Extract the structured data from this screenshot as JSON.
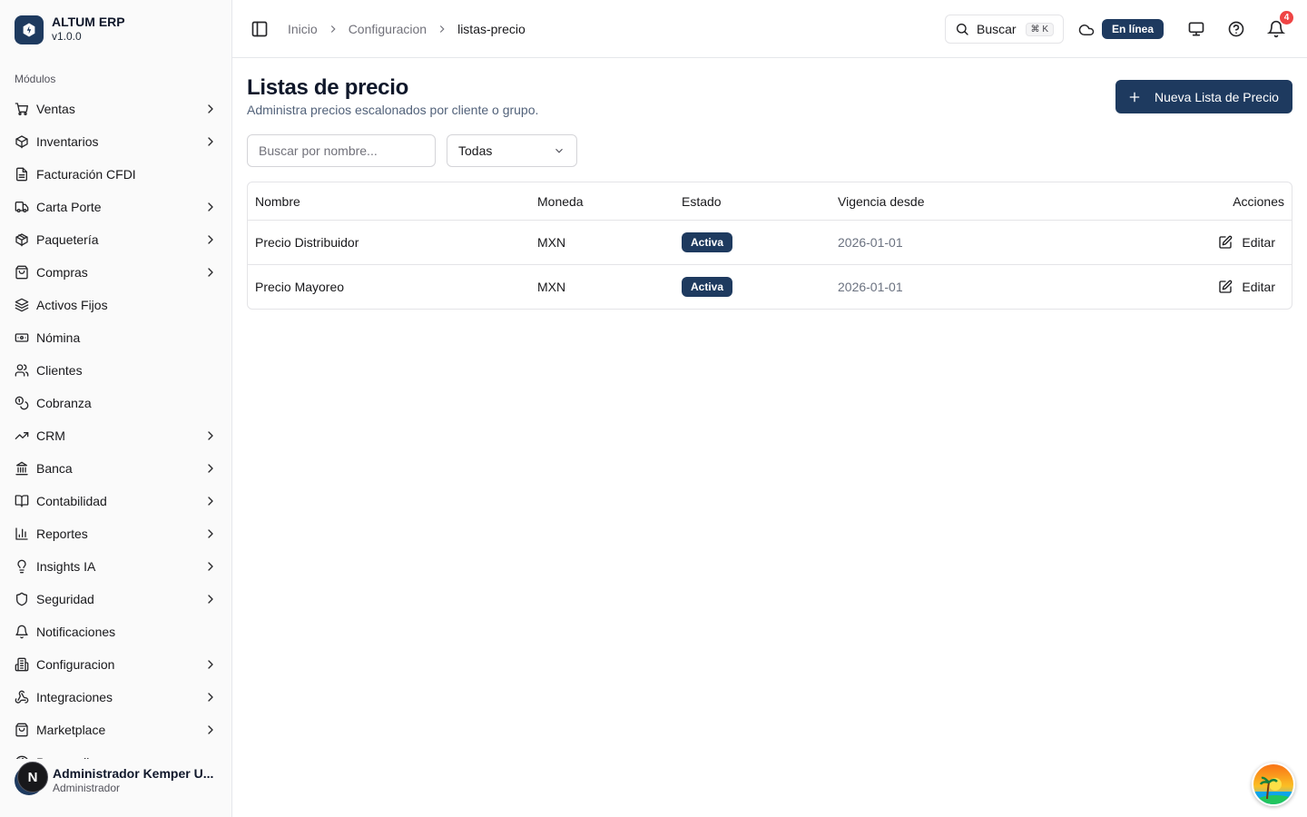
{
  "brand": {
    "name": "ALTUM ERP",
    "version": "v1.0.0"
  },
  "sidebar": {
    "section_title": "Módulos",
    "items": [
      {
        "label": "Ventas",
        "icon": "cart-icon",
        "has_children": true
      },
      {
        "label": "Inventarios",
        "icon": "box-icon",
        "has_children": true
      },
      {
        "label": "Facturación CFDI",
        "icon": "file-icon",
        "has_children": false
      },
      {
        "label": "Carta Porte",
        "icon": "truck-icon",
        "has_children": true
      },
      {
        "label": "Paquetería",
        "icon": "package-icon",
        "has_children": true
      },
      {
        "label": "Compras",
        "icon": "shopping-bag-icon",
        "has_children": true
      },
      {
        "label": "Activos Fijos",
        "icon": "layers-icon",
        "has_children": false
      },
      {
        "label": "Nómina",
        "icon": "banknote-icon",
        "has_children": false
      },
      {
        "label": "Clientes",
        "icon": "users-icon",
        "has_children": false
      },
      {
        "label": "Cobranza",
        "icon": "coins-icon",
        "has_children": false
      },
      {
        "label": "CRM",
        "icon": "trending-up-icon",
        "has_children": true
      },
      {
        "label": "Banca",
        "icon": "bank-icon",
        "has_children": true
      },
      {
        "label": "Contabilidad",
        "icon": "book-icon",
        "has_children": true
      },
      {
        "label": "Reportes",
        "icon": "bar-chart-icon",
        "has_children": true
      },
      {
        "label": "Insights IA",
        "icon": "lightbulb-icon",
        "has_children": true
      },
      {
        "label": "Seguridad",
        "icon": "shield-icon",
        "has_children": true
      },
      {
        "label": "Notificaciones",
        "icon": "bell-icon",
        "has_children": false
      },
      {
        "label": "Configuracion",
        "icon": "building-icon",
        "has_children": true
      },
      {
        "label": "Integraciones",
        "icon": "webhook-icon",
        "has_children": true
      },
      {
        "label": "Marketplace",
        "icon": "store-icon",
        "has_children": true
      },
      {
        "label": "Personalizar",
        "icon": "palette-icon",
        "has_children": false
      }
    ]
  },
  "user": {
    "name": "Administrador Kemper U...",
    "role": "Administrador",
    "initial": "N"
  },
  "header": {
    "breadcrumbs": [
      "Inicio",
      "Configuracion",
      "listas-precio"
    ],
    "search_label": "Buscar",
    "search_shortcut": "⌘ K",
    "status": "En línea",
    "notification_count": "4"
  },
  "main": {
    "title": "Listas de precio",
    "subtitle": "Administra precios escalonados por cliente o grupo.",
    "new_button": "Nueva Lista de Precio",
    "search_placeholder": "Buscar por nombre...",
    "filter_value": "Todas",
    "table": {
      "columns": [
        "Nombre",
        "Moneda",
        "Estado",
        "Vigencia desde",
        "Acciones"
      ],
      "rows": [
        {
          "nombre": "Precio Distribuidor",
          "moneda": "MXN",
          "estado": "Activa",
          "vigencia": "2026-01-01",
          "accion": "Editar"
        },
        {
          "nombre": "Precio Mayoreo",
          "moneda": "MXN",
          "estado": "Activa",
          "vigencia": "2026-01-01",
          "accion": "Editar"
        }
      ]
    }
  },
  "colors": {
    "primary": "#1e3a5f",
    "badge_red": "#ef4444",
    "border": "#e4e4e7"
  }
}
